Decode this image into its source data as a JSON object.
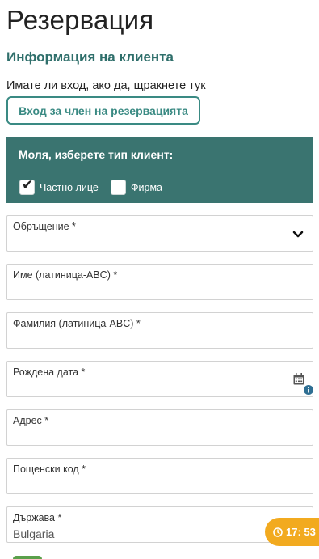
{
  "page": {
    "title": "Резервация",
    "section_title": "Информация на клиента"
  },
  "login": {
    "prompt": "Имате ли вход, ако да, щракнете тук",
    "button_label": "Вход за член на резервацията"
  },
  "client_type": {
    "title": "Моля, изберете тип клиент:",
    "options": [
      {
        "label": "Частно лице",
        "checked": true
      },
      {
        "label": "Фирма",
        "checked": false
      }
    ]
  },
  "fields": {
    "salutation": {
      "label": "Обръщение *",
      "value": ""
    },
    "first_name": {
      "label": "Име (латиница-ABC) *",
      "value": ""
    },
    "last_name": {
      "label": "Фамилия (латиница-ABC) *",
      "value": ""
    },
    "birth_date": {
      "label": "Рождена дата *",
      "value": ""
    },
    "address": {
      "label": "Адрес *",
      "value": ""
    },
    "postal_code": {
      "label": "Пощенски код *",
      "value": ""
    },
    "country": {
      "label": "Държава *",
      "value": "Bulgaria"
    }
  },
  "timer": {
    "text": "17: 53"
  },
  "colors": {
    "accent": "#3a8a83",
    "panel": "#3a7470",
    "timer": "#f2aa1f"
  }
}
